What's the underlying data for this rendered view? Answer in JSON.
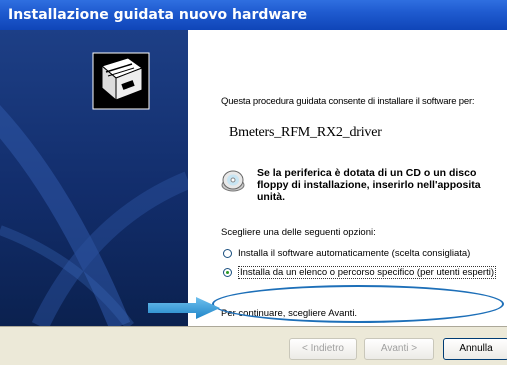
{
  "window": {
    "title": "Installazione guidata nuovo hardware"
  },
  "content": {
    "intro": "Questa procedura guidata consente di installare il software per:",
    "device_name": "Bmeters_RFM_RX2_driver",
    "cd_hint": "Se la periferica è dotata di un CD o un disco floppy di installazione, inserirlo nell'apposita unità.",
    "choose_label": "Scegliere una delle seguenti opzioni:",
    "options": [
      {
        "label": "Installa il software automaticamente (scelta consigliata)",
        "selected": false
      },
      {
        "label": "Installa da un elenco o percorso specifico (per utenti esperti)",
        "selected": true
      }
    ],
    "continue_text": "Per continuare, scegliere Avanti."
  },
  "buttons": {
    "back": "< Indietro",
    "next": "Avanti >",
    "cancel": "Annulla"
  },
  "colors": {
    "title_bar": "#1f5bd0",
    "sidebar": "#122d6b",
    "highlight_ellipse": "#1d6fb8",
    "arrow": "#3fa0d8",
    "footer": "#ece9d8"
  },
  "icons": [
    "hardware-wizard-icon",
    "cd-icon",
    "pointer-arrow-icon"
  ]
}
